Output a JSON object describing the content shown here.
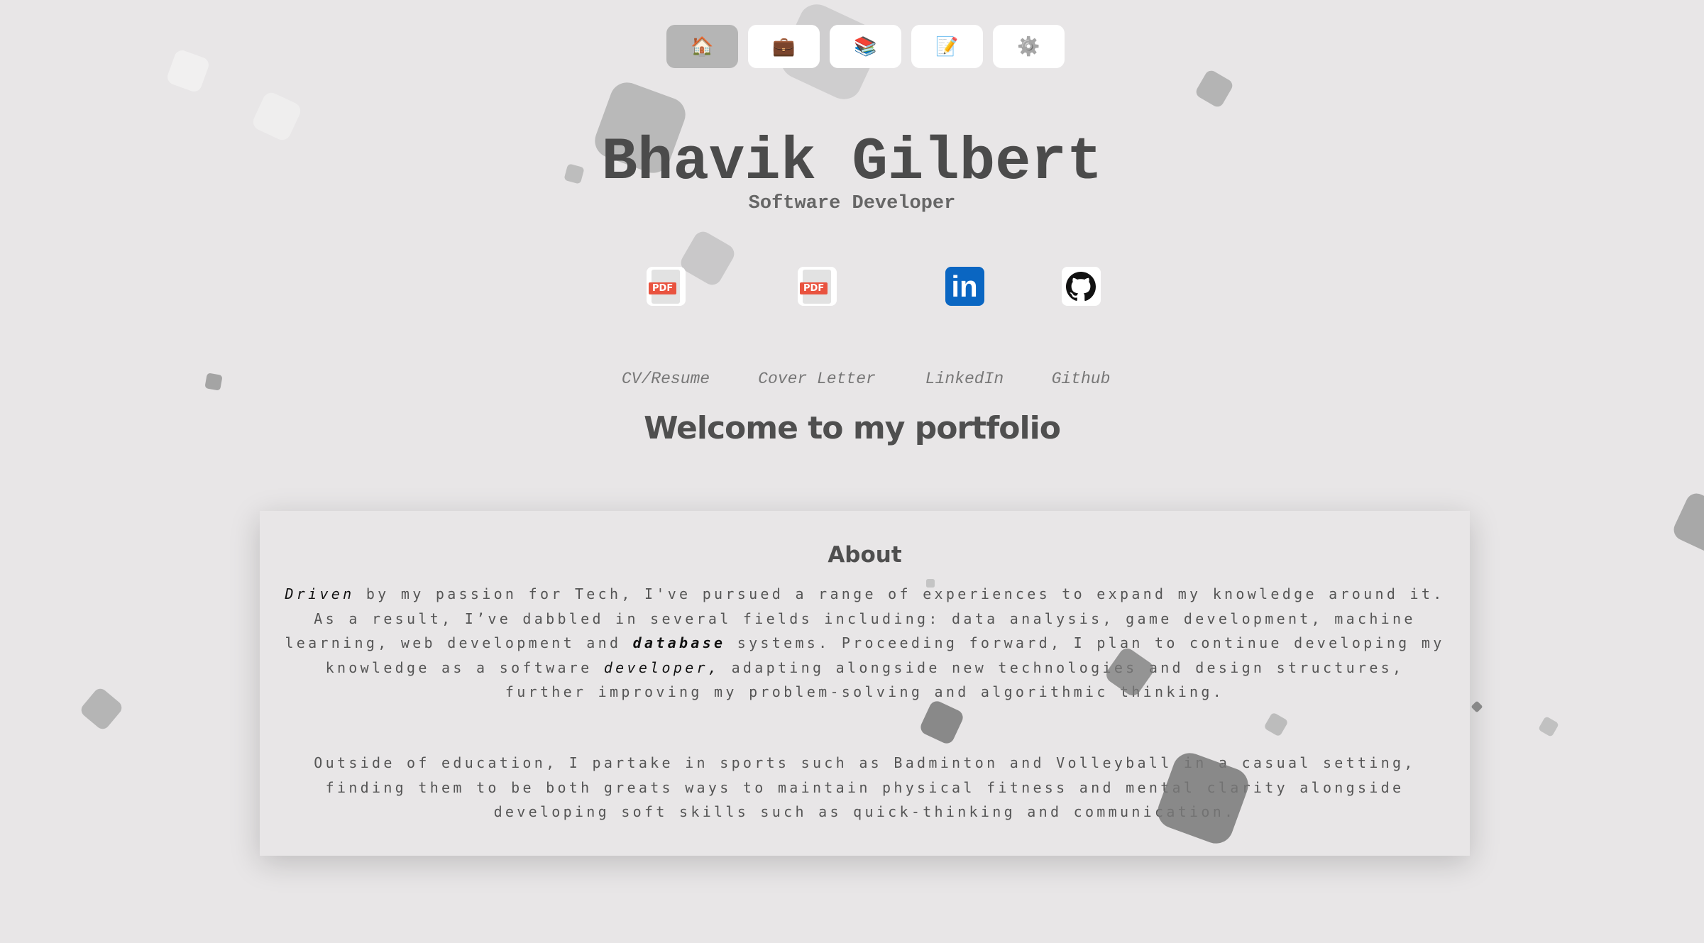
{
  "nav": [
    {
      "name": "home",
      "icon": "🏠",
      "active": true
    },
    {
      "name": "experience",
      "icon": "💼",
      "active": false
    },
    {
      "name": "education",
      "icon": "📚",
      "active": false
    },
    {
      "name": "projects",
      "icon": "📝",
      "active": false
    },
    {
      "name": "settings",
      "icon": "⚙️",
      "active": false
    }
  ],
  "header": {
    "name": "Bhavik Gilbert",
    "role": "Software Developer"
  },
  "links": [
    {
      "label": "CV/Resume",
      "icon": "pdf-icon"
    },
    {
      "label": "Cover Letter",
      "icon": "pdf-icon"
    },
    {
      "label": "LinkedIn",
      "icon": "linkedin-icon",
      "icon_text": "in"
    },
    {
      "label": "Github",
      "icon": "github-icon"
    }
  ],
  "pdf_badge": "PDF",
  "welcome": "Welcome to my portfolio",
  "about": {
    "heading": "About",
    "p1": {
      "driven": "Driven",
      "t1": " by my passion for Tech, I've pursued a range of experiences to expand my knowledge around it. As a result, I’ve dabbled in several fields including: data analysis, game development, machine learning, web development and ",
      "database": "database",
      "t2": " systems. Proceeding forward, I plan to continue developing my knowledge as a software ",
      "developer": "developer,",
      "t3": " adapting alongside new technologies and design structures, further improving my problem-solving and algorithmic thinking."
    },
    "p2": "Outside of education, I partake in sports such as Badminton and Volleyball in a casual setting, finding them to be both greats ways to maintain physical fitness and mental clarity alongside developing soft skills such as quick-thinking and communication."
  },
  "colors": {
    "background": "#e8e6e7",
    "active_nav": "#b5b5b5",
    "linkedin": "#0a66c2",
    "pdf": "#e9533f"
  }
}
